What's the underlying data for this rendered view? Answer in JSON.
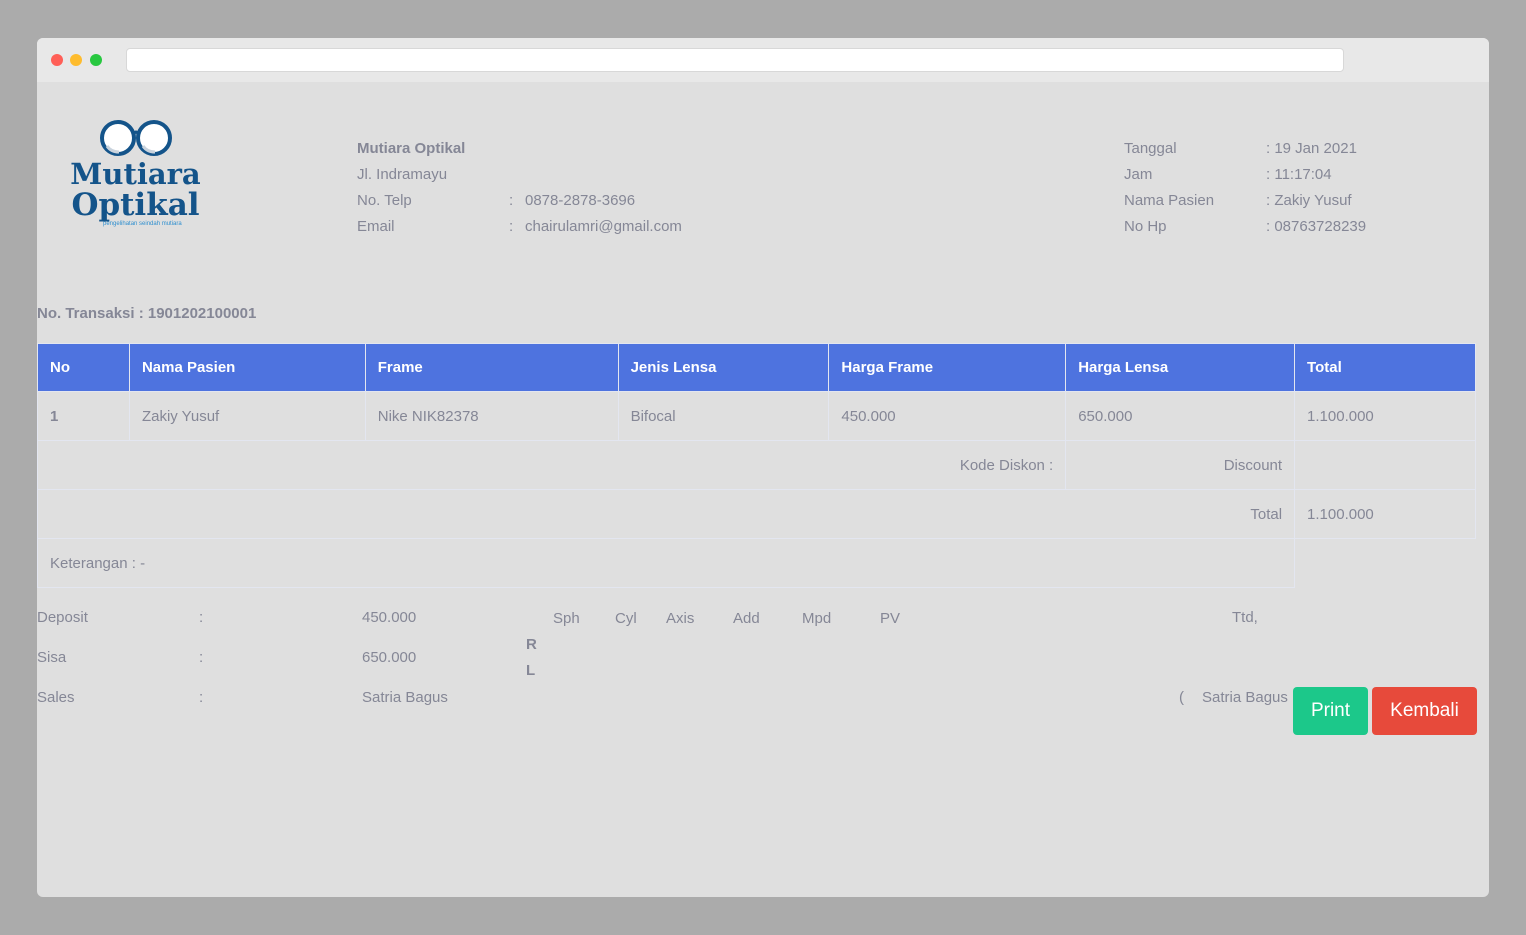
{
  "store": {
    "logo_line1": "Mutiara",
    "logo_line2": "Optikal",
    "logo_tagline": "pengelihatan seindah mutiara",
    "name": "Mutiara Optikal",
    "address": "Jl. Indramayu",
    "phone_label": "No. Telp",
    "phone_value": "0878-2878-3696",
    "email_label": "Email",
    "email_value": "chairulamri@gmail.com",
    "sep": ":"
  },
  "meta": {
    "date_label": "Tanggal",
    "date_value": ": 19 Jan 2021",
    "time_label": "Jam",
    "time_value": ": 11:17:04",
    "patient_label": "Nama Pasien",
    "patient_value": ": Zakiy Yusuf",
    "hp_label": "No Hp",
    "hp_value": ": 08763728239"
  },
  "transaction": "No. Transaksi : 1901202100001",
  "table": {
    "headers": [
      "No",
      "Nama Pasien",
      "Frame",
      "Jenis Lensa",
      "Harga Frame",
      "Harga Lensa",
      "Total"
    ],
    "row": [
      "1",
      "Zakiy Yusuf",
      "Nike NIK82378",
      "Bifocal",
      "450.000",
      "650.000",
      "1.100.000"
    ],
    "kode_diskon_label": "Kode Diskon :",
    "discount_label": "Discount",
    "discount_value": "",
    "total_label": "Total",
    "total_value": "1.100.000",
    "keterangan": "Keterangan : -"
  },
  "payment": {
    "deposit_label": "Deposit",
    "deposit_value": "450.000",
    "sisa_label": "Sisa",
    "sisa_value": "650.000",
    "sales_label": "Sales",
    "sales_value": "Satria Bagus",
    "sep": ":"
  },
  "prescription": {
    "cols": [
      "Sph",
      "Cyl",
      "Axis",
      "Add",
      "Mpd",
      "PV"
    ],
    "rows": [
      "R",
      "L"
    ]
  },
  "signature": {
    "label": "Ttd,",
    "open": "(",
    "name": "Satria Bagus",
    "close": ")"
  },
  "buttons": {
    "print": "Print",
    "back": "Kembali"
  },
  "colors": {
    "table_header": "#4e73df",
    "print_button": "#1cc88a",
    "back_button": "#e74a3b",
    "logo": "#14548a"
  }
}
